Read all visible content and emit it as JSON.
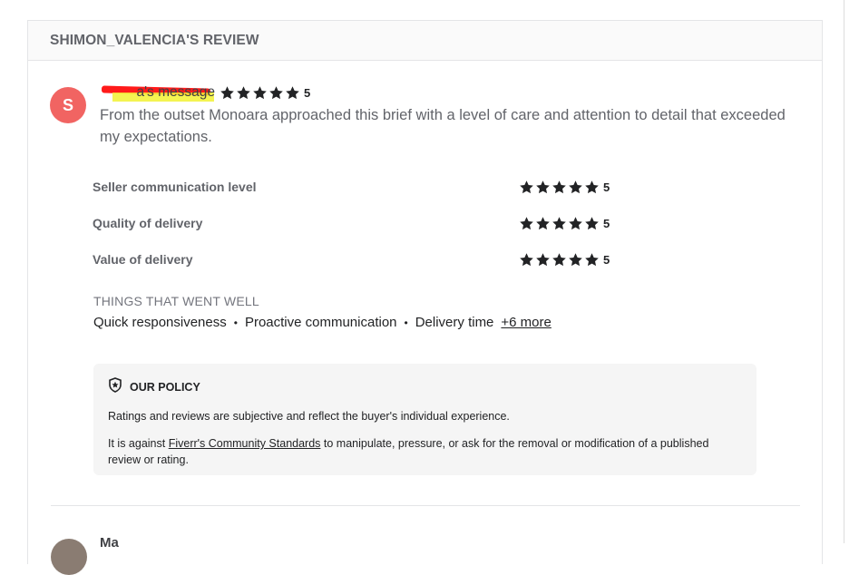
{
  "panel": {
    "title": "SHIMON_VALENCIA'S REVIEW"
  },
  "review": {
    "avatar_initial": "S",
    "message_suffix": "a's message",
    "overall_rating": "5",
    "text": "From the outset Monoara approached this brief with a level of care and attention to detail that exceeded my expectations."
  },
  "criteria": [
    {
      "label": "Seller communication level",
      "rating": "5"
    },
    {
      "label": "Quality of delivery",
      "rating": "5"
    },
    {
      "label": "Value of delivery",
      "rating": "5"
    }
  ],
  "went_well": {
    "title": "THINGS THAT WENT WELL",
    "tags": [
      "Quick responsiveness",
      "Proactive communication",
      "Delivery time"
    ],
    "more": "+6 more"
  },
  "policy": {
    "title": "OUR POLICY",
    "p1": "Ratings and reviews are subjective and reflect the buyer's individual experience.",
    "p2_before": "It is against ",
    "p2_link": "Fiverr's Community Standards",
    "p2_after": " to manipulate, pressure, or ask for the removal or modification of a published review or rating."
  },
  "next_review": {
    "name_partial": "Ma"
  },
  "colors": {
    "avatar": "#f16462",
    "star": "#222325",
    "policy_bg": "#f5f5f5"
  },
  "icons": {
    "star": "star-icon",
    "policy": "shield-star-icon"
  }
}
